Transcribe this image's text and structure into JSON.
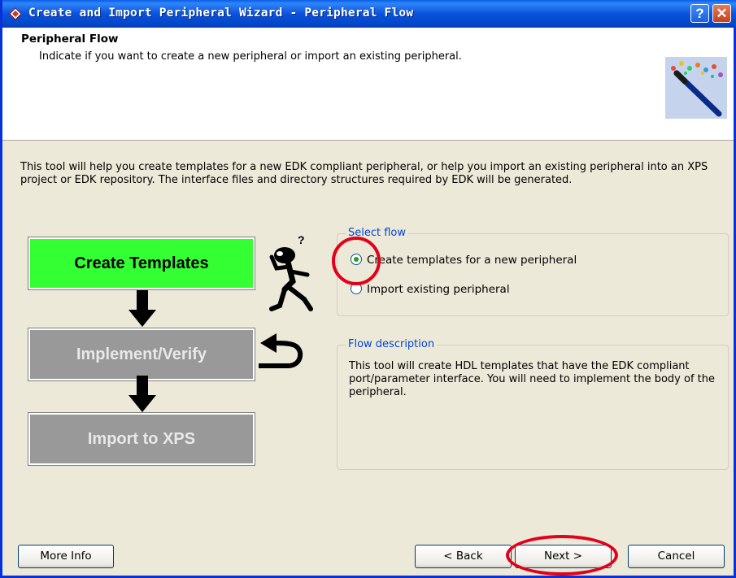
{
  "window": {
    "title": "Create and Import Peripheral Wizard - Peripheral Flow",
    "help_label": "?",
    "close_label": "✕"
  },
  "header": {
    "title": "Peripheral Flow",
    "subtitle": "Indicate if you want to create a new peripheral or import an existing peripheral."
  },
  "intro": "This tool will help you create templates for a new EDK compliant peripheral, or help you import an existing peripheral into an XPS project or EDK repository. The interface files and directory structures required by EDK will be generated.",
  "flow_diagram": {
    "steps": [
      "Create Templates",
      "Implement/Verify",
      "Import to XPS"
    ]
  },
  "select_flow": {
    "label": "Select flow",
    "options": [
      {
        "label": "Create templates for a new peripheral",
        "selected": true
      },
      {
        "label": "Import existing peripheral",
        "selected": false
      }
    ]
  },
  "flow_description": {
    "label": "Flow description",
    "text": "This tool will create HDL templates that have the EDK compliant port/parameter interface. You will need to implement the body of the peripheral."
  },
  "buttons": {
    "more_info": "More Info",
    "back": "< Back",
    "next": "Next >",
    "cancel": "Cancel"
  },
  "colors": {
    "title_bar": "#0a53dd",
    "active_step": "#33ff33",
    "inactive_step": "#999999",
    "highlight_circle": "#e3001b"
  }
}
